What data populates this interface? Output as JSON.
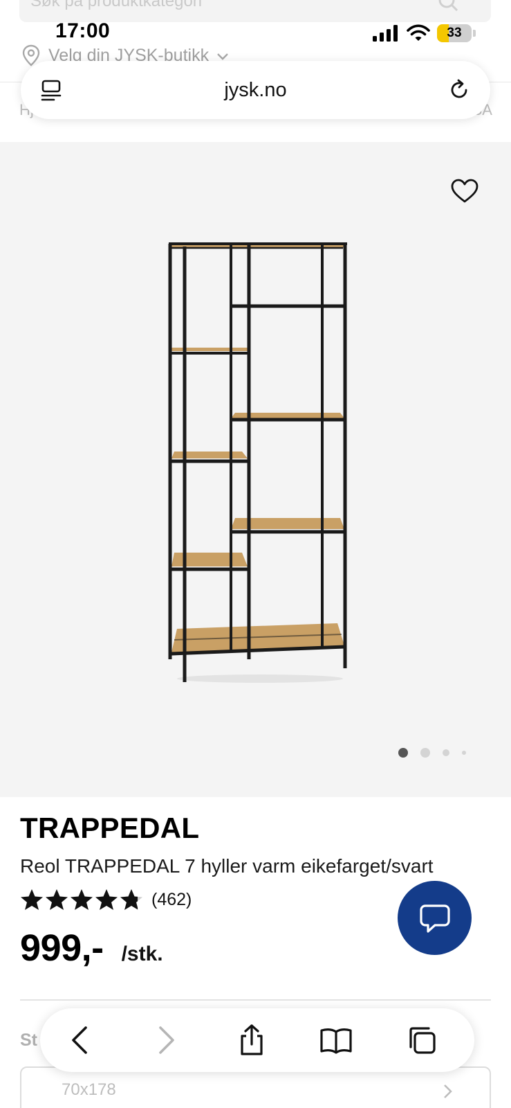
{
  "underlay": {
    "search_placeholder": "Søk på produktkategori",
    "store_selector": "Velg din JYSK-butikk",
    "breadcrumb_start": "Hj",
    "breadcrumb_end": "SA"
  },
  "status_bar": {
    "time": "17:00",
    "battery_level": "33",
    "battery_fraction": 0.33
  },
  "browser": {
    "url": "jysk.no"
  },
  "gallery": {
    "image_count": 4,
    "active_index": 0
  },
  "product": {
    "brand": "TRAPPEDAL",
    "name": "Reol TRAPPEDAL 7 hyller varm eikefarget/svart",
    "rating_stars": 4.7,
    "rating_count": "(462)",
    "price": "999,-",
    "price_unit": "/stk."
  },
  "size_section": {
    "label": "St",
    "value": "70x178"
  },
  "colors": {
    "chat_button": "#143c8a",
    "image_background": "#f4f4f4",
    "battery_fill": "#f4c700"
  },
  "icons": {
    "menu": "reader-icon",
    "reload": "reload-icon",
    "favorite": "heart-icon",
    "chat": "chat-bubble-icon",
    "back": "chevron-left-icon",
    "forward": "chevron-right-icon",
    "share": "share-icon",
    "bookmarks": "book-icon",
    "tabs": "tabs-icon"
  }
}
